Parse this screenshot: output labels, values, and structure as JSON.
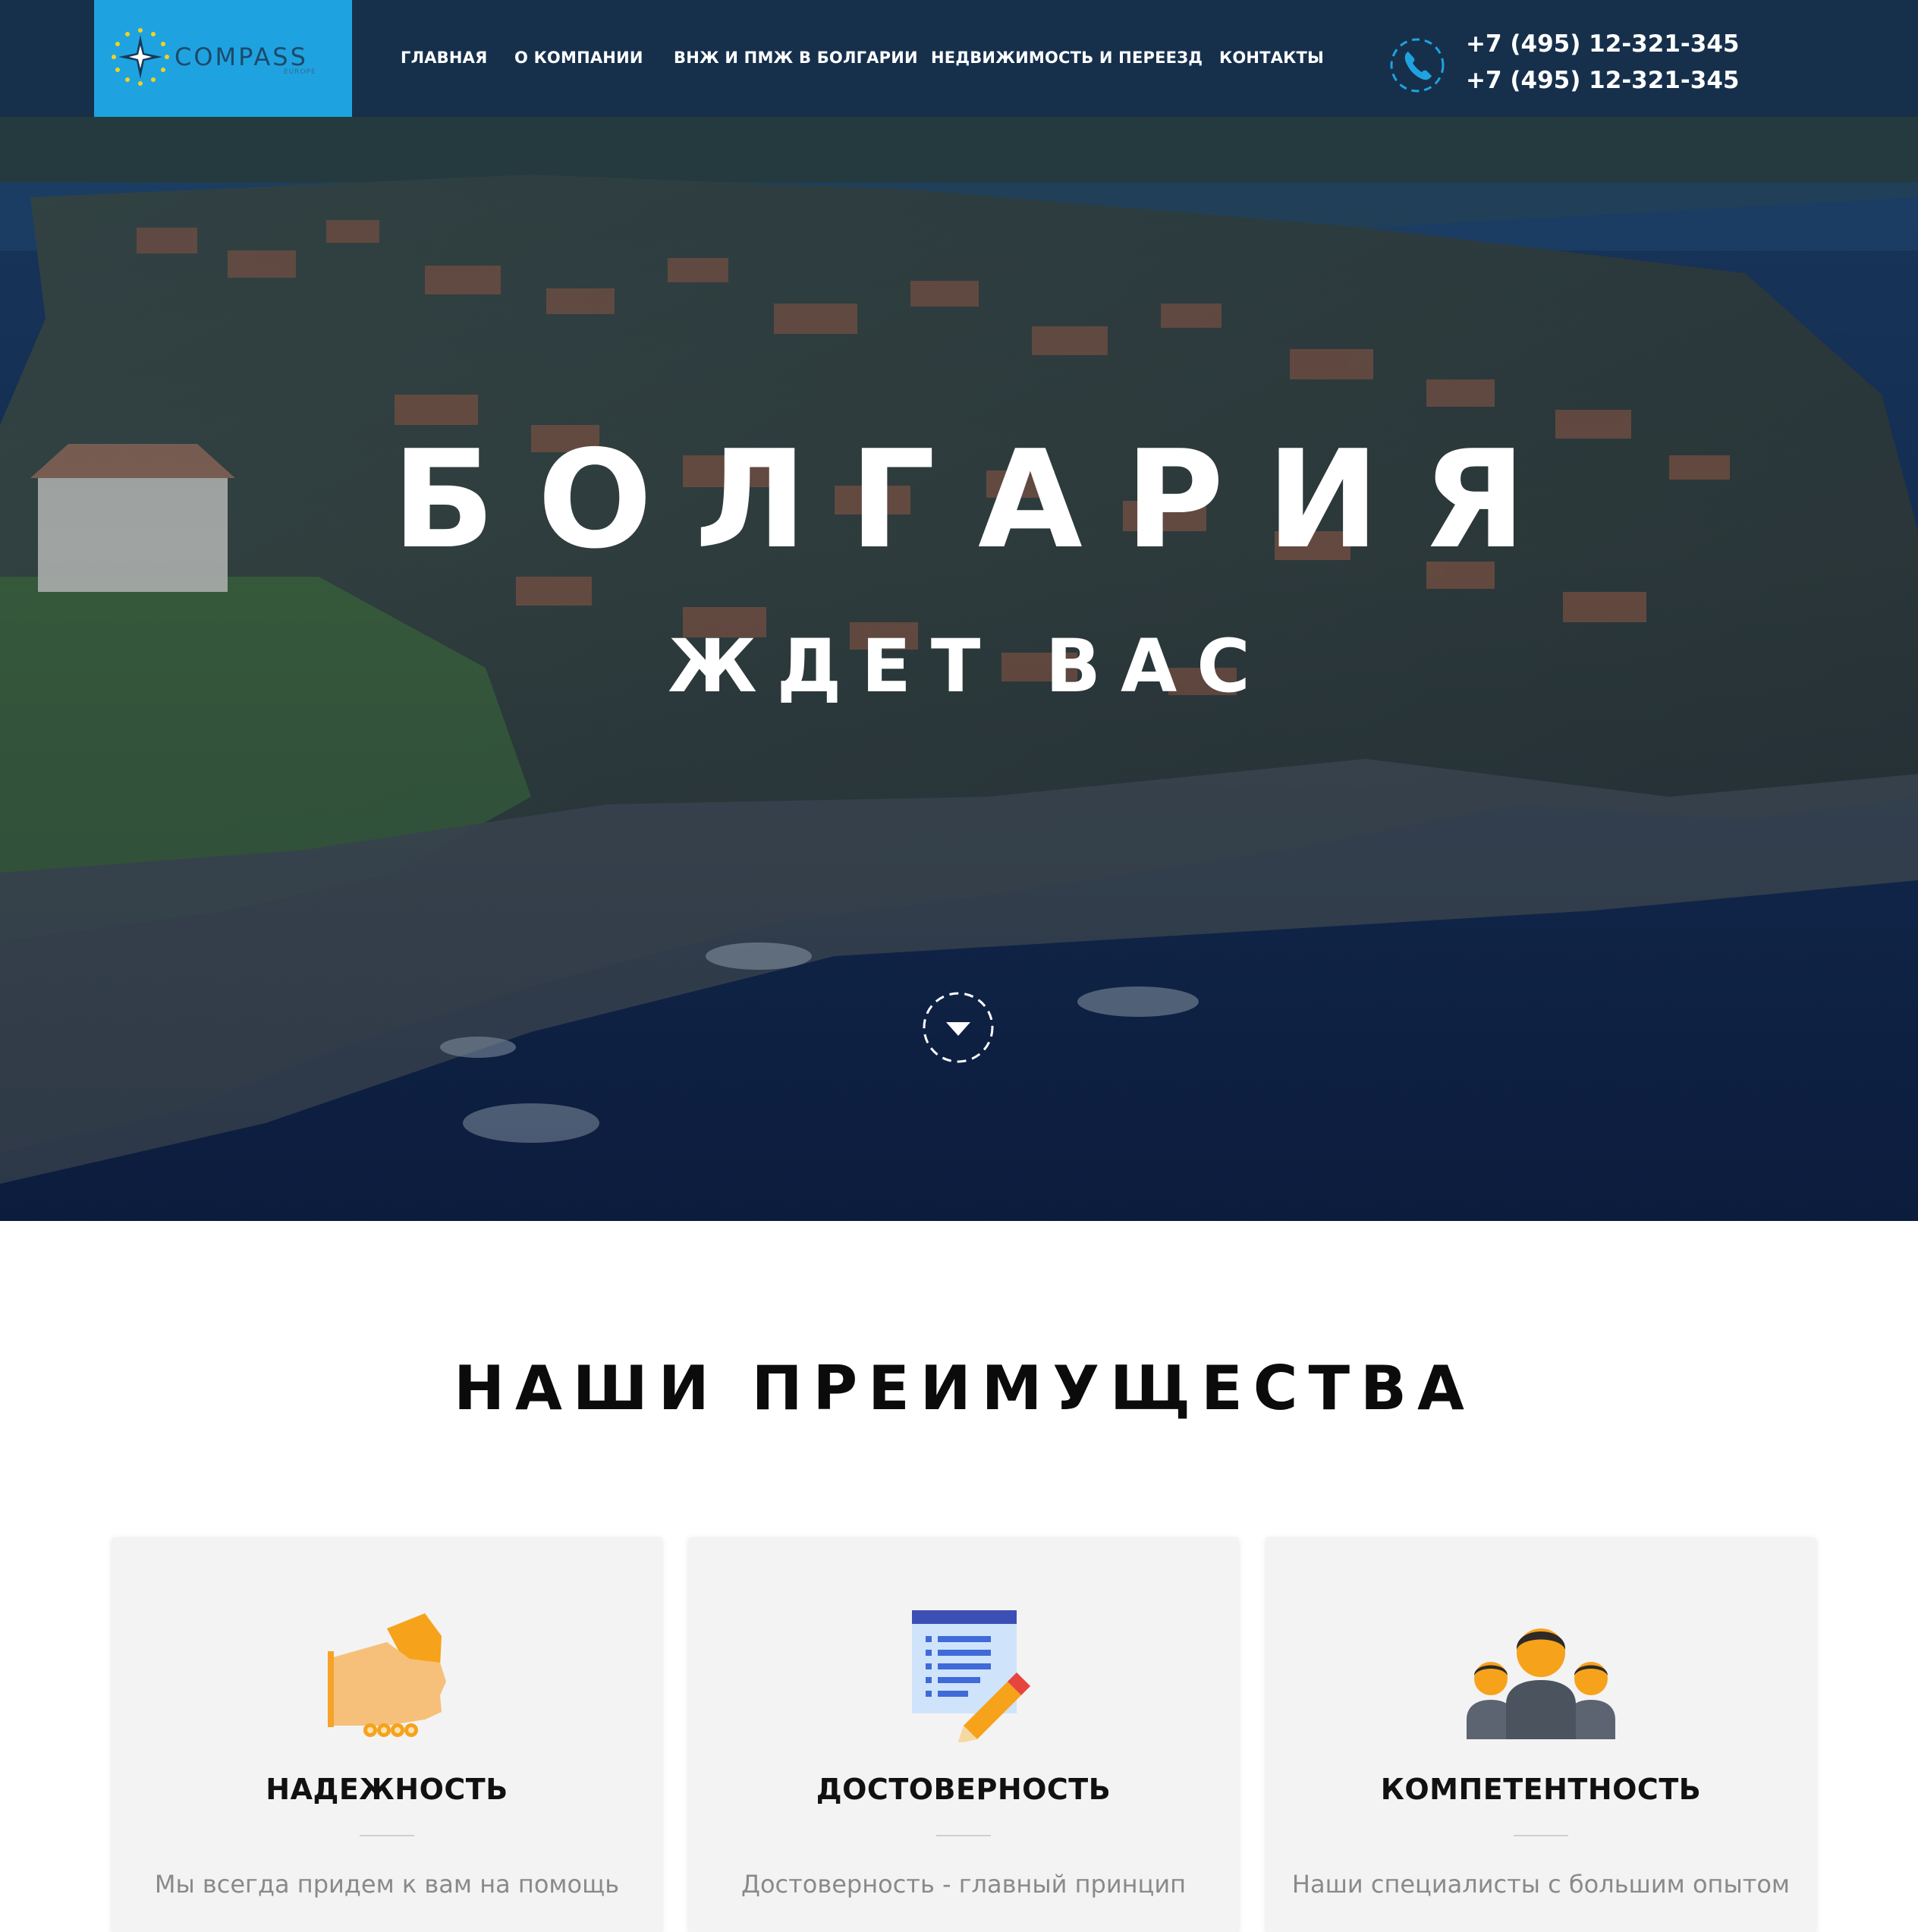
{
  "header": {
    "logo_text": "COMPASS",
    "logo_sub": "EUROPE",
    "nav": [
      {
        "label": "ГЛАВНАЯ"
      },
      {
        "label": "О КОМПАНИИ"
      },
      {
        "label": "ВНЖ И ПМЖ В БОЛГАРИИ"
      },
      {
        "label": "НЕДВИЖИМОСТЬ И ПЕРЕЕЗД"
      },
      {
        "label": "КОНТАКТЫ"
      }
    ],
    "phones": [
      "+7 (495) 12-321-345",
      "+7 (495) 12-321-345"
    ]
  },
  "hero": {
    "title": "БОЛГАРИЯ",
    "subtitle": "ЖДЕТ ВАС",
    "scroll_icon": "chevron-down-icon"
  },
  "advantages": {
    "title": "НАШИ ПРЕИМУЩЕСТВА",
    "cards": [
      {
        "icon": "handshake-icon",
        "title": "НАДЕЖНОСТЬ",
        "text": "Мы всегда придем к вам на помощь"
      },
      {
        "icon": "document-edit-icon",
        "title": "ДОСТОВЕРНОСТЬ",
        "text": "Достоверность - главный принцип"
      },
      {
        "icon": "team-icon",
        "title": "КОМПЕТЕНТНОСТЬ",
        "text": "Наши специалисты с большим опытом"
      }
    ]
  },
  "colors": {
    "accent": "#1fa3e0",
    "header_bg": "#162e48",
    "icon_orange": "#f7a21b",
    "icon_blue": "#3f51b5"
  }
}
